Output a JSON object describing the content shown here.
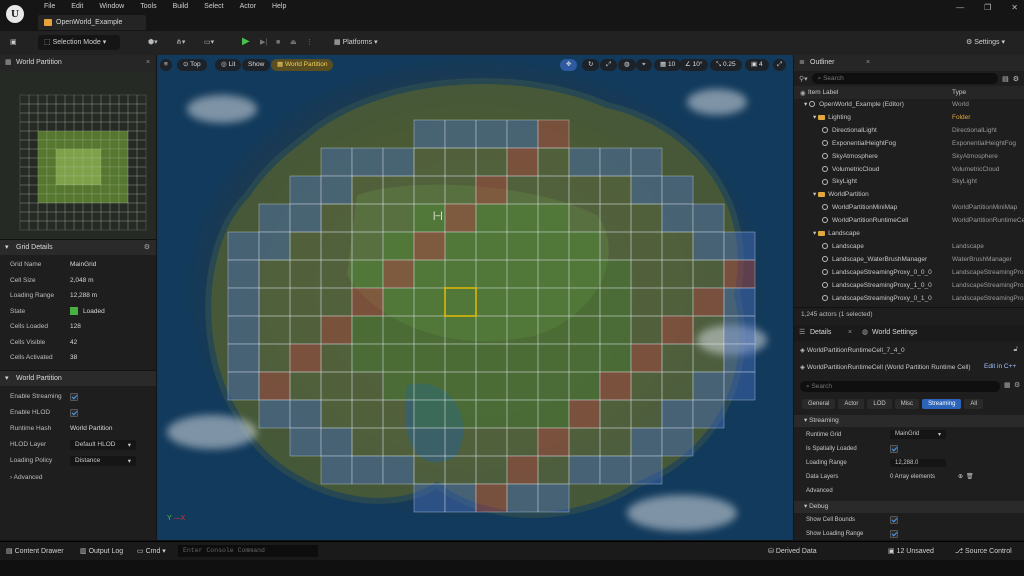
{
  "titlebar": {
    "menu": [
      "File",
      "Edit",
      "Window",
      "Tools",
      "Build",
      "Select",
      "Actor",
      "Help"
    ],
    "project_tab": "OpenWorld_Example",
    "logo": "U"
  },
  "toolbar": {
    "selection_mode": "Selection Mode",
    "platforms": "Platforms",
    "settings": "Settings"
  },
  "world_partition_panel": {
    "tab": "World Partition"
  },
  "grid_details": {
    "header": "Grid Details",
    "rows": [
      {
        "k": "Grid Name",
        "v": "MainGrid"
      },
      {
        "k": "Cell Size",
        "v": "2,048 m"
      },
      {
        "k": "Loading Range",
        "v": "12,288 m"
      },
      {
        "k": "State",
        "v": "Loaded"
      },
      {
        "k": "Cells Loaded",
        "v": "128"
      },
      {
        "k": "Cells Visible",
        "v": "42"
      },
      {
        "k": "Cells Activated",
        "v": "38"
      }
    ]
  },
  "world_partition_section": {
    "header": "World Partition",
    "enable_streaming": "Enable Streaming",
    "enable_hlod": "Enable HLOD",
    "runtime_hash_label": "Runtime Hash",
    "runtime_hash": "World Partition",
    "hlod_layer_label": "HLOD Layer",
    "hlod_layer": "Default HLOD",
    "loading_policy_label": "Loading Policy",
    "loading_policy": "Distance",
    "advanced": "Advanced"
  },
  "viewport": {
    "top": "Top",
    "lit": "Lit",
    "show": "Show",
    "world_partition": "World Partition",
    "snap_grid": "10",
    "snap_rot": "10°",
    "snap_scale": "0.25",
    "cam_speed": "4"
  },
  "outliner": {
    "tab": "Outliner",
    "search_placeholder": "Search",
    "col_label": "Item Label",
    "col_type": "Type",
    "items": [
      {
        "name": "OpenWorld_Example (Editor)",
        "type": "World",
        "level": 0,
        "kind": "world"
      },
      {
        "name": "Lighting",
        "type": "Folder",
        "level": 1,
        "kind": "folder"
      },
      {
        "name": "DirectionalLight",
        "type": "DirectionalLight",
        "level": 2,
        "kind": "actor"
      },
      {
        "name": "ExponentialHeightFog",
        "type": "ExponentialHeightFog",
        "level": 2,
        "kind": "actor"
      },
      {
        "name": "SkyAtmosphere",
        "type": "SkyAtmosphere",
        "level": 2,
        "kind": "actor"
      },
      {
        "name": "VolumetricCloud",
        "type": "VolumetricCloud",
        "level": 2,
        "kind": "actor"
      },
      {
        "name": "SkyLight",
        "type": "SkyLight",
        "level": 2,
        "kind": "actor"
      },
      {
        "name": "WorldPartition",
        "type": "",
        "level": 1,
        "kind": "folder"
      },
      {
        "name": "WorldPartitionMiniMap",
        "type": "WorldPartitionMiniMap",
        "level": 2,
        "kind": "actor"
      },
      {
        "name": "WorldPartitionRuntimeCell",
        "type": "WorldPartitionRuntimeCe",
        "level": 2,
        "kind": "actor"
      },
      {
        "name": "Landscape",
        "type": "",
        "level": 1,
        "kind": "folder"
      },
      {
        "name": "Landscape",
        "type": "Landscape",
        "level": 2,
        "kind": "actor"
      },
      {
        "name": "Landscape_WaterBrushManager",
        "type": "WaterBrushManager",
        "level": 2,
        "kind": "actor"
      },
      {
        "name": "LandscapeStreamingProxy_0_0_0",
        "type": "LandscapeStreamingProx",
        "level": 2,
        "kind": "actor"
      },
      {
        "name": "LandscapeStreamingProxy_1_0_0",
        "type": "LandscapeStreamingProx",
        "level": 2,
        "kind": "actor"
      },
      {
        "name": "LandscapeStreamingProxy_0_1_0",
        "type": "LandscapeStreamingProx",
        "level": 2,
        "kind": "actor"
      }
    ],
    "count": "1,245 actors (1 selected)"
  },
  "details": {
    "tab": "Details",
    "tab2": "World Settings",
    "object": "WorldPartitionRuntimeCell_7_4_0",
    "class_line": "WorldPartitionRuntimeCell (World Partition Runtime Cell)",
    "edit_cpp": "Edit in C++",
    "search_placeholder": "Search",
    "categories": [
      "General",
      "Actor",
      "LOD",
      "Misc",
      "Streaming",
      "All"
    ],
    "streaming_header": "Streaming",
    "runtime_grid_label": "Runtime Grid",
    "runtime_grid": "MainGrid",
    "spatial_label": "Is Spatially Loaded",
    "loading_range_label": "Loading Range",
    "loading_range": "12,288.0",
    "data_layers_label": "Data Layers",
    "data_layers": "0 Array elements",
    "advanced": "Advanced",
    "debug_header": "Debug",
    "show_bounds": "Show Cell Bounds",
    "show_range": "Show Loading Range"
  },
  "status": {
    "content_drawer": "Content Drawer",
    "output_log": "Output Log",
    "cmd": "Cmd",
    "console_placeholder": "Enter Console Command",
    "derived_data": "Derived Data",
    "unsaved": "12 Unsaved",
    "source_control": "Source Control"
  }
}
